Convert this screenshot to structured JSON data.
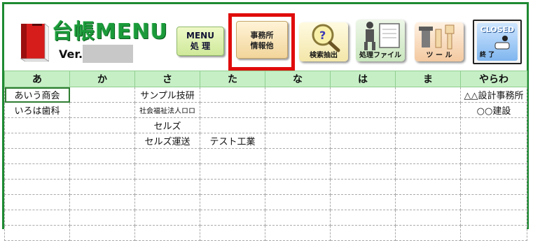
{
  "header": {
    "title": "台帳MENU",
    "version_label": "Ver.",
    "version_value": ""
  },
  "toolbar": {
    "menu_button": "MENU\n処 理",
    "office_button": "事務所\n情報他",
    "search_button": "検索抽出",
    "file_button": "処理ファイル",
    "tool_button": "ツ ー ル",
    "closed_button": "CLOSED",
    "closed_sub": "終 了"
  },
  "accent": {
    "green": "#1e8a32",
    "highlight_red": "#e00c0c",
    "header_row": "#c6efc6"
  },
  "grid": {
    "columns": [
      "あ",
      "か",
      "さ",
      "た",
      "な",
      "は",
      "ま",
      "やらわ"
    ],
    "rows": [
      [
        "あいう商会",
        "",
        "サンプル技研",
        "",
        "",
        "",
        "",
        "△△設計事務所"
      ],
      [
        "いろは歯科",
        "",
        "社会福祉法人ロロ",
        "",
        "",
        "",
        "",
        "○○建設"
      ],
      [
        "",
        "",
        "セルズ",
        "",
        "",
        "",
        "",
        ""
      ],
      [
        "",
        "",
        "セルズ運送",
        "テスト工業",
        "",
        "",
        "",
        ""
      ],
      [
        "",
        "",
        "",
        "",
        "",
        "",
        "",
        ""
      ],
      [
        "",
        "",
        "",
        "",
        "",
        "",
        "",
        ""
      ],
      [
        "",
        "",
        "",
        "",
        "",
        "",
        "",
        ""
      ],
      [
        "",
        "",
        "",
        "",
        "",
        "",
        "",
        ""
      ],
      [
        "",
        "",
        "",
        "",
        "",
        "",
        "",
        ""
      ],
      [
        "",
        "",
        "",
        "",
        "",
        "",
        "",
        ""
      ]
    ]
  }
}
